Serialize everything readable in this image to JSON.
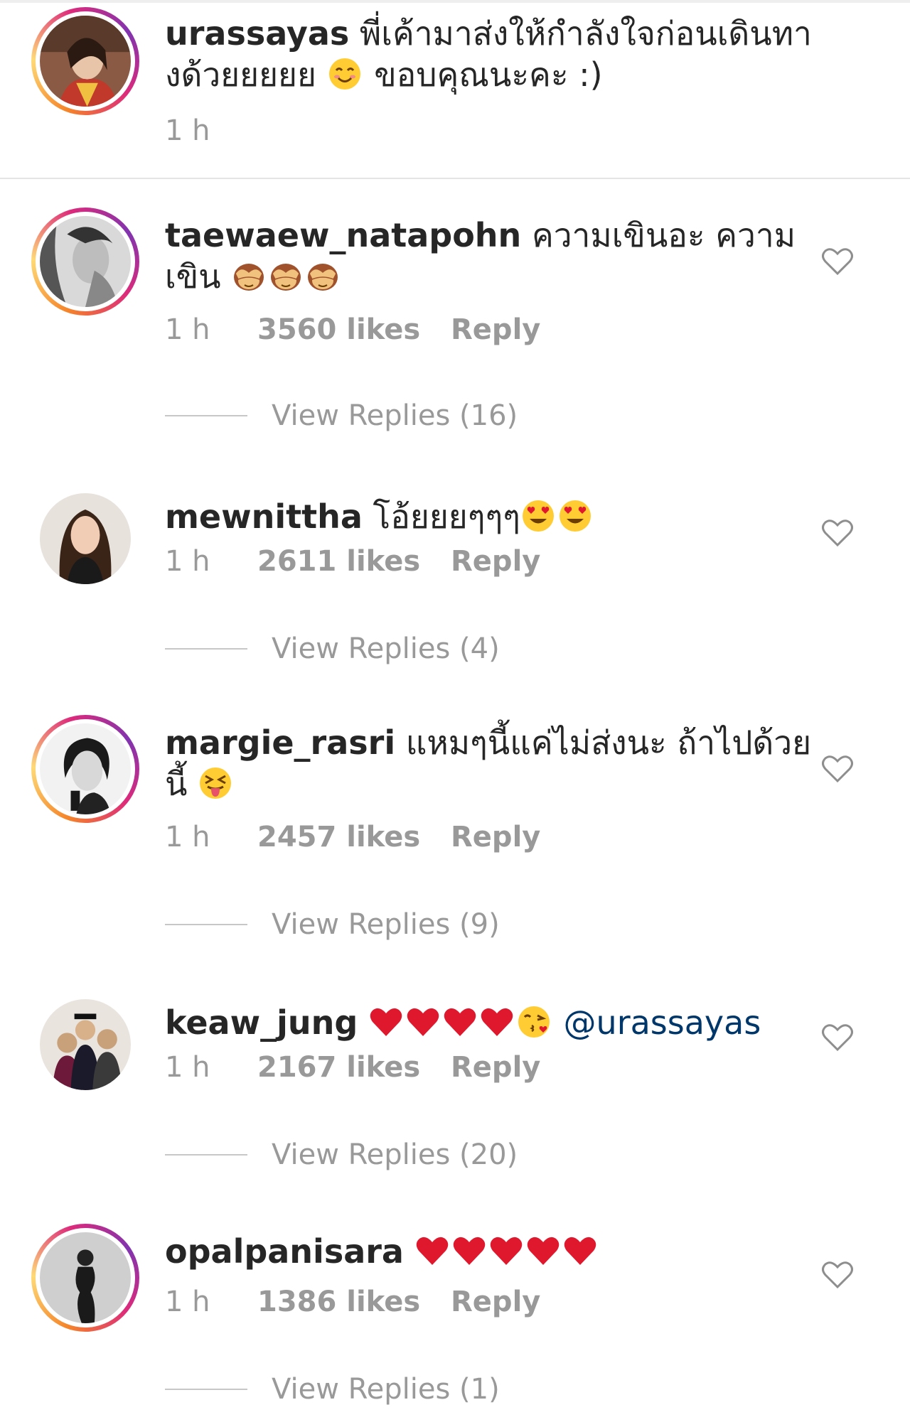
{
  "caption": {
    "username": "urassayas",
    "text_line1": "พี่เค้ามาส่งให้กำลังใจก่อนเดินทา",
    "text_line2_a": "งด้วยยยยย",
    "emoji": "smiling-face-icon",
    "text_line2_b": "ขอบคุณนะคะ :)",
    "time": "1 h"
  },
  "comments": [
    {
      "username": "taewaew_natapohn",
      "text_line1": "ความเขินอะ ความ",
      "text_line2": "เขิน",
      "emojis": [
        "see-no-evil-monkey-icon",
        "see-no-evil-monkey-icon",
        "see-no-evil-monkey-icon"
      ],
      "time": "1 h",
      "likes": "3560 likes",
      "reply": "Reply",
      "view_replies": "View Replies (16)"
    },
    {
      "username": "mewnittha",
      "text_line1": "โอ้ยยยๆๆๆ",
      "emojis": [
        "heart-eyes-face-icon",
        "heart-eyes-face-icon"
      ],
      "time": "1 h",
      "likes": "2611 likes",
      "reply": "Reply",
      "view_replies": "View Replies (4)"
    },
    {
      "username": "margie_rasri",
      "text_line1": "แหมๆนี้แค่ไม่ส่งนะ ถ้าไปด้วย",
      "text_line2": "นี้",
      "emojis": [
        "squinting-tongue-face-icon"
      ],
      "time": "1 h",
      "likes": "2457 likes",
      "reply": "Reply",
      "view_replies": "View Replies (9)"
    },
    {
      "username": "keaw_jung",
      "emojis": [
        "red-heart-icon",
        "red-heart-icon",
        "red-heart-icon",
        "red-heart-icon",
        "face-blowing-kiss-icon"
      ],
      "mention": "@urassayas",
      "time": "1 h",
      "likes": "2167 likes",
      "reply": "Reply",
      "view_replies": "View Replies (20)"
    },
    {
      "username": "opalpanisara",
      "emojis": [
        "red-heart-icon",
        "red-heart-icon",
        "red-heart-icon",
        "red-heart-icon",
        "red-heart-icon"
      ],
      "time": "1 h",
      "likes": "1386 likes",
      "reply": "Reply",
      "view_replies": "View Replies (1)"
    }
  ],
  "colors": {
    "text": "#262626",
    "meta": "#999999",
    "mention": "#00376b",
    "heart_emoji": "#e0182d",
    "story_ring": "#dd2a7b"
  }
}
